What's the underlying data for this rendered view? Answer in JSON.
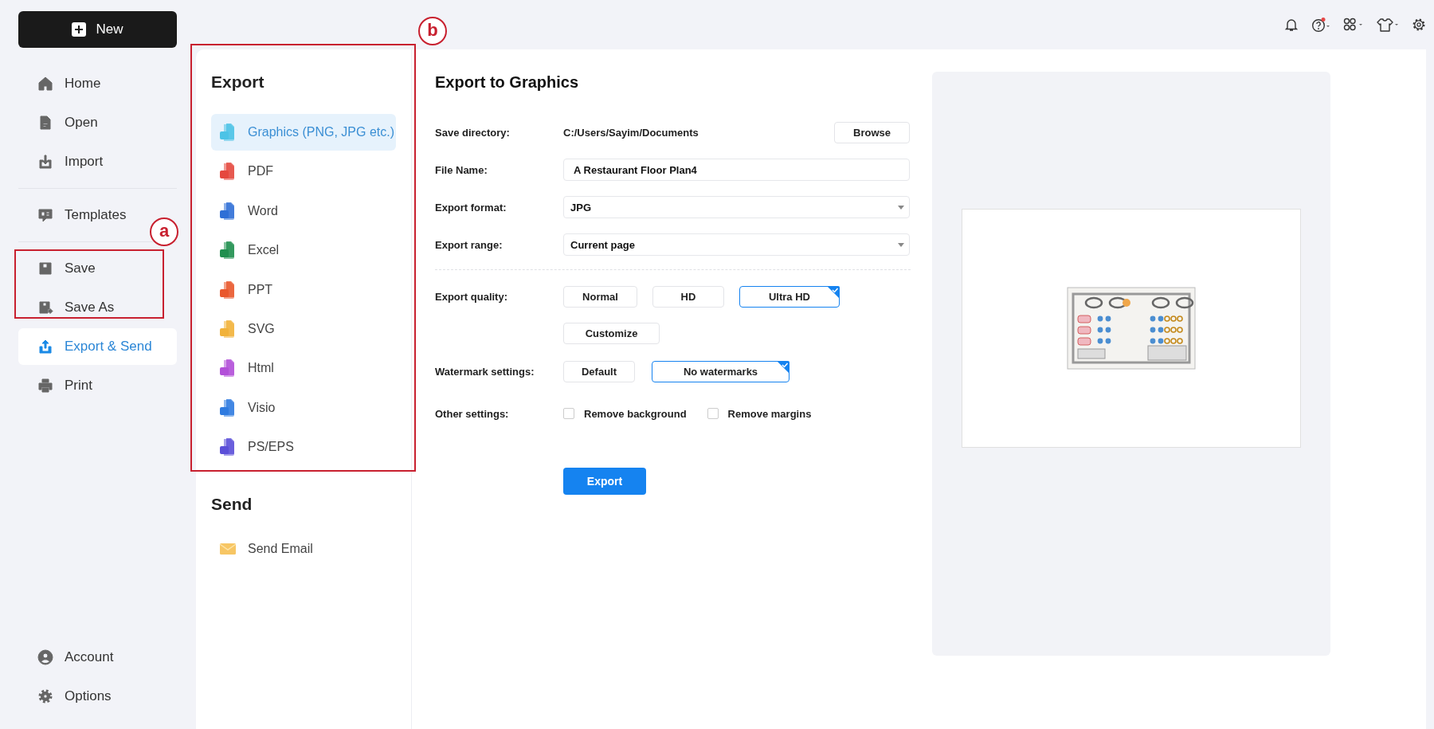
{
  "sidebar": {
    "new_button": "New",
    "groups": [
      [
        {
          "label": "Home",
          "selected": false
        },
        {
          "label": "Open",
          "selected": false
        },
        {
          "label": "Import",
          "selected": false
        }
      ],
      [
        {
          "label": "Templates",
          "selected": false
        }
      ],
      [
        {
          "label": "Save",
          "selected": false
        },
        {
          "label": "Save As",
          "selected": false
        },
        {
          "label": "Export & Send",
          "selected": true
        },
        {
          "label": "Print",
          "selected": false
        }
      ]
    ],
    "bottom": [
      {
        "label": "Account",
        "selected": false
      },
      {
        "label": "Options",
        "selected": false
      }
    ]
  },
  "export_list": {
    "heading": "Export",
    "items": [
      {
        "label": "Graphics (PNG, JPG etc.)",
        "selected": true
      },
      {
        "label": "PDF",
        "selected": false
      },
      {
        "label": "Word",
        "selected": false
      },
      {
        "label": "Excel",
        "selected": false
      },
      {
        "label": "PPT",
        "selected": false
      },
      {
        "label": "SVG",
        "selected": false
      },
      {
        "label": "Html",
        "selected": false
      },
      {
        "label": "Visio",
        "selected": false
      },
      {
        "label": "PS/EPS",
        "selected": false
      }
    ]
  },
  "send_list": {
    "heading": "Send",
    "items": [
      {
        "label": "Send Email",
        "selected": false
      }
    ]
  },
  "form": {
    "title": "Export to Graphics",
    "save_directory": {
      "label": "Save directory:",
      "value": "C:/Users/Sayim/Documents",
      "button": "Browse"
    },
    "file_name": {
      "label": "File Name:",
      "value": "A Restaurant Floor Plan4"
    },
    "export_format": {
      "label": "Export format:",
      "value": "JPG"
    },
    "export_range": {
      "label": "Export range:",
      "value": "Current page"
    },
    "export_quality": {
      "label": "Export quality:",
      "options": [
        {
          "label": "Normal",
          "selected": false
        },
        {
          "label": "HD",
          "selected": false
        },
        {
          "label": "Ultra HD",
          "selected": true
        }
      ],
      "customize": "Customize"
    },
    "watermark": {
      "label": "Watermark settings:",
      "options": [
        {
          "label": "Default",
          "selected": false
        },
        {
          "label": "No watermarks",
          "selected": true
        }
      ]
    },
    "other": {
      "label": "Other settings:",
      "options": [
        {
          "label": "Remove background",
          "checked": false
        },
        {
          "label": "Remove margins",
          "checked": false
        }
      ]
    },
    "export_button": "Export"
  },
  "annotations": [
    {
      "label": "a"
    },
    {
      "label": "b"
    }
  ]
}
